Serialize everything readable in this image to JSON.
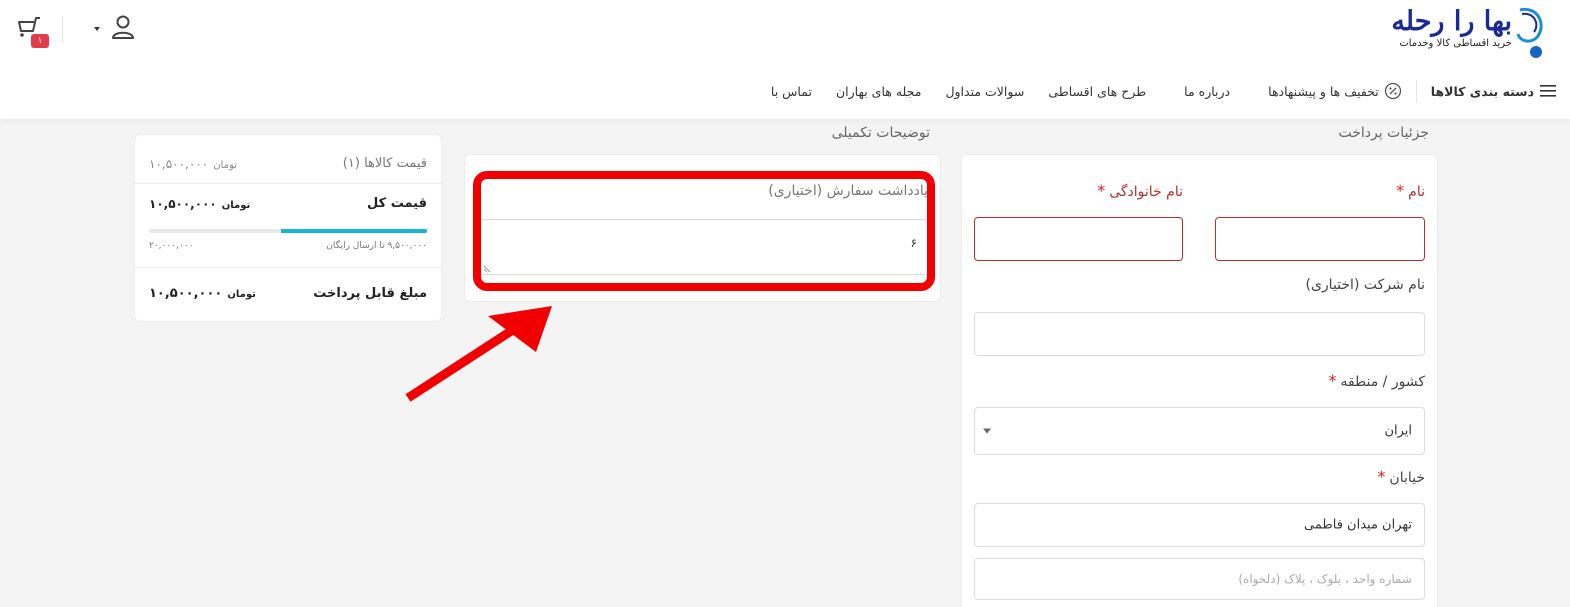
{
  "logo": {
    "title": "بها را رحله",
    "subtitle": "خرید اقساطی کالا وخدمات"
  },
  "header": {
    "cart_count": "۱"
  },
  "nav": {
    "categories": "دسته بندی کالاها",
    "offers": "تخفیف ها و پیشنهادها",
    "about": "درباره ما",
    "plans": "طرح های اقساطی",
    "faq": "سوالات متداول",
    "magazine": "مجله های بهاران",
    "contact": "تماس با"
  },
  "billing": {
    "section_title": "جزئیات پرداخت",
    "first_name_label": "نام",
    "last_name_label": "نام خانوادگی",
    "company_label": "نام شرکت (اختیاری)",
    "country_label": "کشور / منطقه",
    "country_value": "ایران",
    "street_label": "خیابان",
    "street_value": "تهران میدان فاطمی",
    "street2_placeholder": "شماره واحد ، بلوک ، پلاک (دلخواه)",
    "required_mark": "*"
  },
  "notes": {
    "section_title": "توضیحات تکمیلی",
    "label": "یادداشت سفارش (اختیاری)",
    "value": "۶"
  },
  "summary": {
    "items_label": "قیمت کالاها (۱)",
    "items_value": "۱۰,۵۰۰,۰۰۰",
    "total_label": "قیمت کل",
    "total_value": "۱۰,۵۰۰,۰۰۰",
    "shipping_note": "۹,۵۰۰,۰۰۰ تا ارسال رایگان",
    "shipping_target": "۲۰,۰۰۰,۰۰۰",
    "shipping_progress": 0.525,
    "payable_label": "مبلغ قابل پرداخت",
    "payable_value": "۱۰,۵۰۰,۰۰۰",
    "currency": "تومان"
  },
  "colors": {
    "accent": "#16b5d4",
    "required": "#e02020",
    "error_border": "#b0322e",
    "annotation": "#f20000",
    "brand": "#1a2a9a"
  }
}
